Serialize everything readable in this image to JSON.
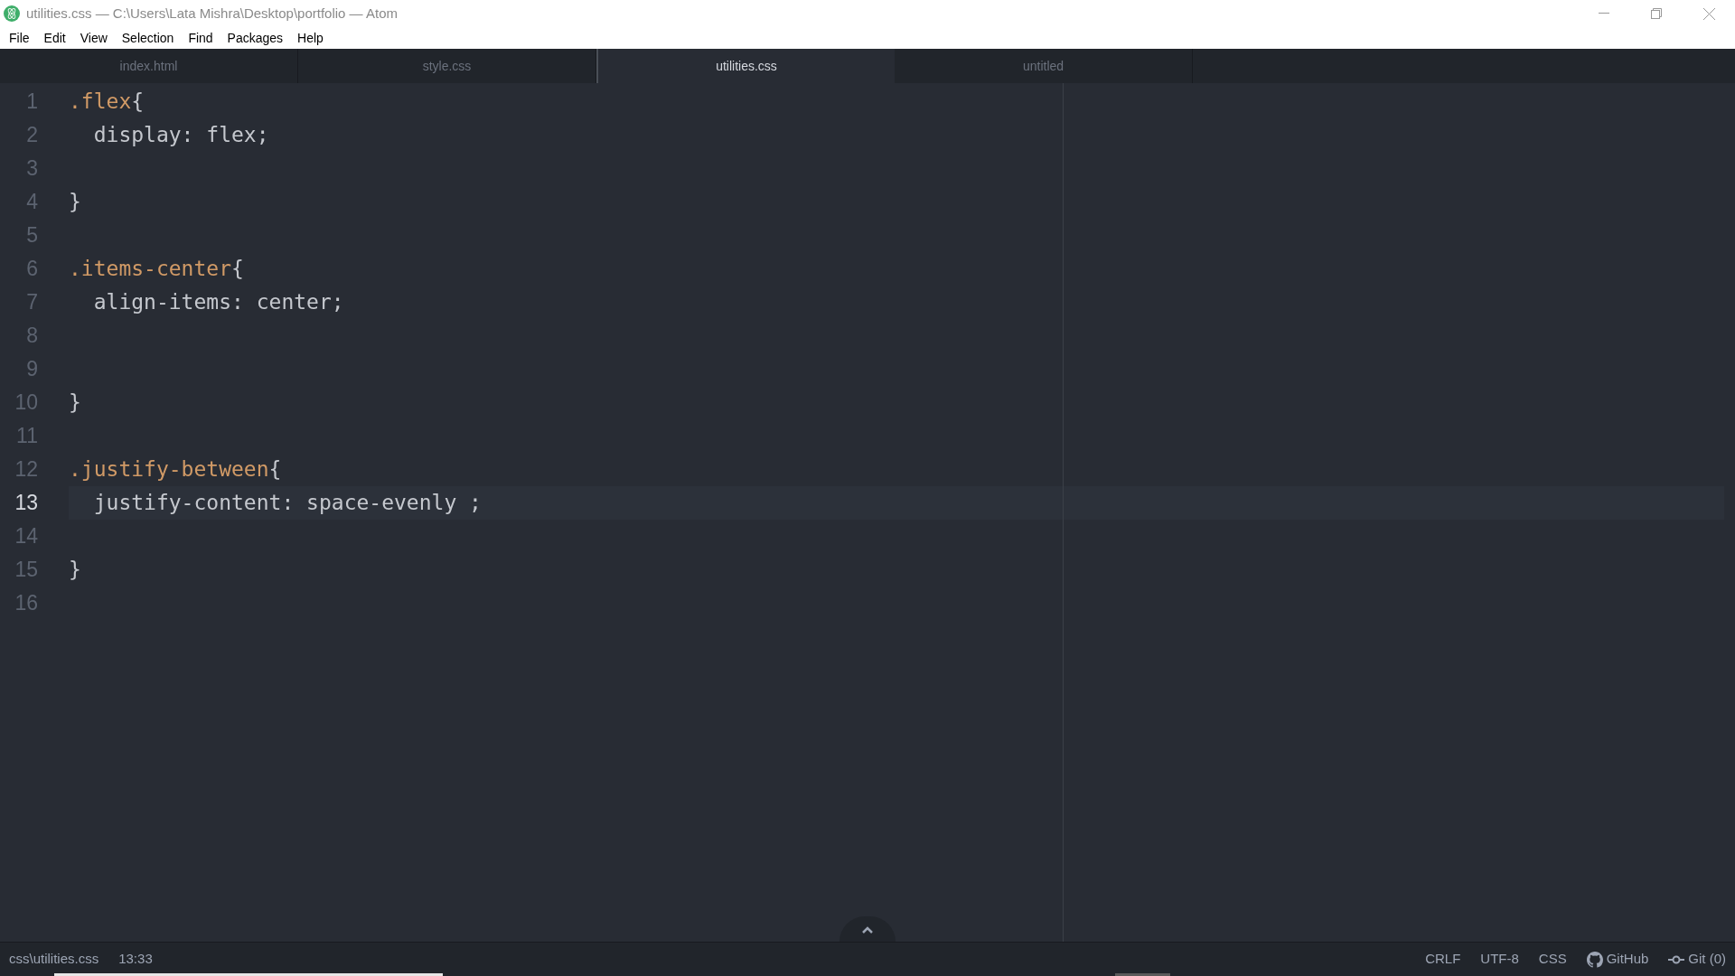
{
  "window": {
    "title": "utilities.css — C:\\Users\\Lata Mishra\\Desktop\\portfolio — Atom"
  },
  "menu": [
    "File",
    "Edit",
    "View",
    "Selection",
    "Find",
    "Packages",
    "Help"
  ],
  "tabs": [
    {
      "label": "index.html",
      "selected": false
    },
    {
      "label": "style.css",
      "selected": false
    },
    {
      "label": "utilities.css",
      "selected": true
    },
    {
      "label": "untitled",
      "selected": false
    }
  ],
  "editor": {
    "lines": [
      {
        "number": "1",
        "current": false,
        "tokens": [
          {
            "kind": "selector",
            "text": ".flex"
          },
          {
            "kind": "plain",
            "text": "{"
          }
        ]
      },
      {
        "number": "2",
        "current": false,
        "tokens": [
          {
            "kind": "plain",
            "text": "  display: flex;"
          }
        ]
      },
      {
        "number": "3",
        "current": false
      },
      {
        "number": "4",
        "current": false,
        "tokens": [
          {
            "kind": "plain",
            "text": "}"
          }
        ]
      },
      {
        "number": "5",
        "current": false
      },
      {
        "number": "6",
        "current": false,
        "tokens": [
          {
            "kind": "selector",
            "text": ".items-center"
          },
          {
            "kind": "plain",
            "text": "{"
          }
        ]
      },
      {
        "number": "7",
        "current": false,
        "tokens": [
          {
            "kind": "plain",
            "text": "  align-items: center;"
          }
        ]
      },
      {
        "number": "8",
        "current": false
      },
      {
        "number": "9",
        "current": false
      },
      {
        "number": "10",
        "current": false,
        "tokens": [
          {
            "kind": "plain",
            "text": "}"
          }
        ]
      },
      {
        "number": "11",
        "current": false
      },
      {
        "number": "12",
        "current": false,
        "tokens": [
          {
            "kind": "selector",
            "text": ".justify-between"
          },
          {
            "kind": "plain",
            "text": "{"
          }
        ]
      },
      {
        "number": "13",
        "current": true,
        "tokens": [
          {
            "kind": "plain",
            "text": "  justify-content: space-evenly ;"
          }
        ]
      },
      {
        "number": "14",
        "current": false
      },
      {
        "number": "15",
        "current": false,
        "tokens": [
          {
            "kind": "plain",
            "text": "}"
          }
        ]
      },
      {
        "number": "16",
        "current": false
      }
    ]
  },
  "status_bar": {
    "file": "css\\utilities.css",
    "cursor": "13:33",
    "line_ending": "CRLF",
    "encoding": "UTF-8",
    "grammar": "CSS",
    "github": "GitHub",
    "git": "Git (0)"
  }
}
